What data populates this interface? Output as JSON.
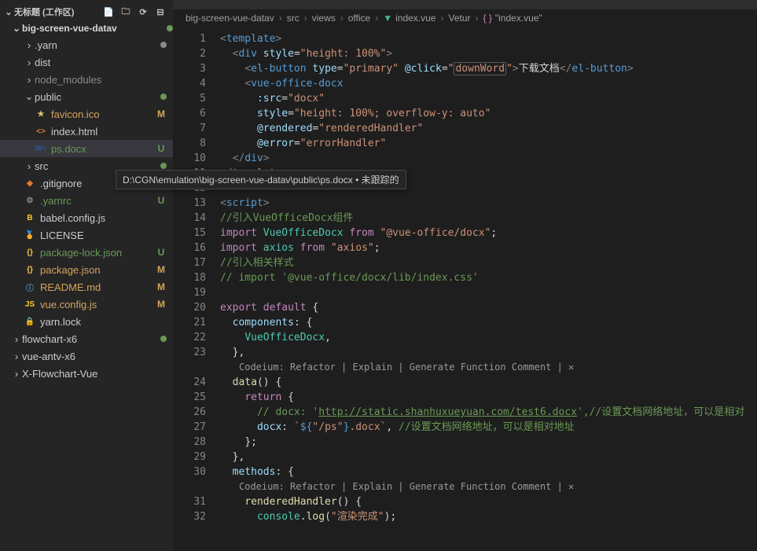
{
  "sidebar": {
    "title": "",
    "workspace": "无标题 (工作区)",
    "project": "big-screen-vue-datav",
    "tree": [
      {
        "depth": 1,
        "kind": "folder",
        "name": ".yarn",
        "status": "",
        "chev": ">",
        "cls": "fldr",
        "dot": "d"
      },
      {
        "depth": 1,
        "kind": "folder",
        "name": "dist",
        "status": "",
        "chev": ">",
        "cls": "fldr"
      },
      {
        "depth": 1,
        "kind": "folder",
        "name": "node_modules",
        "status": "",
        "chev": ">",
        "cls": "file-gray"
      },
      {
        "depth": 1,
        "kind": "folder",
        "name": "public",
        "status": "",
        "chev": "v",
        "cls": "fldr",
        "dot": "u",
        "active": false
      },
      {
        "depth": 2,
        "kind": "file",
        "name": "favicon.ico",
        "status": "M",
        "cls": "file-m",
        "icon": "star",
        "iconColor": "#e8c16f"
      },
      {
        "depth": 2,
        "kind": "file",
        "name": "index.html",
        "status": "",
        "cls": "file-n",
        "icon": "html",
        "iconColor": "#e37933"
      },
      {
        "depth": 2,
        "kind": "file",
        "name": "ps.docx",
        "status": "U",
        "cls": "file-u",
        "icon": "word",
        "iconColor": "#2b579a",
        "active": true
      },
      {
        "depth": 1,
        "kind": "folder",
        "name": "src",
        "status": "",
        "chev": ">",
        "cls": "fldr",
        "dot": "u"
      },
      {
        "depth": 1,
        "kind": "file",
        "name": ".gitignore",
        "status": "",
        "cls": "file-n",
        "icon": "git",
        "iconColor": "#e37933"
      },
      {
        "depth": 1,
        "kind": "file",
        "name": ".yarnrc",
        "status": "U",
        "cls": "file-u",
        "icon": "gear",
        "iconColor": "#8a8a8a"
      },
      {
        "depth": 1,
        "kind": "file",
        "name": "babel.config.js",
        "status": "",
        "cls": "file-n",
        "icon": "babel",
        "iconColor": "#ffca28"
      },
      {
        "depth": 1,
        "kind": "file",
        "name": "LICENSE",
        "status": "",
        "cls": "file-n",
        "icon": "cert",
        "iconColor": "#d4b73f"
      },
      {
        "depth": 1,
        "kind": "file",
        "name": "package-lock.json",
        "status": "U",
        "cls": "file-u",
        "icon": "json",
        "iconColor": "#f3c14b"
      },
      {
        "depth": 1,
        "kind": "file",
        "name": "package.json",
        "status": "M",
        "cls": "file-m",
        "icon": "json",
        "iconColor": "#f3c14b"
      },
      {
        "depth": 1,
        "kind": "file",
        "name": "README.md",
        "status": "M",
        "cls": "file-m",
        "icon": "info",
        "iconColor": "#519aba"
      },
      {
        "depth": 1,
        "kind": "file",
        "name": "vue.config.js",
        "status": "M",
        "cls": "file-m",
        "icon": "js",
        "iconColor": "#ffca28"
      },
      {
        "depth": 1,
        "kind": "file",
        "name": "yarn.lock",
        "status": "",
        "cls": "file-n",
        "icon": "lock",
        "iconColor": "#8a8a8a"
      },
      {
        "depth": 0,
        "kind": "folder",
        "name": "flowchart-x6",
        "status": "",
        "chev": ">",
        "cls": "fldr",
        "dot": "u"
      },
      {
        "depth": 0,
        "kind": "folder",
        "name": "vue-antv-x6",
        "status": "",
        "chev": ">",
        "cls": "fldr"
      },
      {
        "depth": 0,
        "kind": "folder",
        "name": "X-Flowchart-Vue",
        "status": "",
        "chev": ">",
        "cls": "fldr"
      }
    ]
  },
  "breadcrumbs": [
    "big-screen-vue-datav",
    "src",
    "views",
    "office",
    "index.vue",
    "Vetur",
    "\"index.vue\""
  ],
  "tooltip": "D:\\CGN\\emulation\\big-screen-vue-datav\\public\\ps.docx • 未跟踪的",
  "codelens": "Codeium: Refactor | Explain | Generate Function Comment | ✕",
  "lines": [
    1,
    2,
    3,
    4,
    5,
    6,
    7,
    8,
    10,
    11,
    12,
    13,
    14,
    15,
    16,
    17,
    18,
    19,
    20,
    21,
    22,
    23,
    24,
    25,
    26,
    27,
    28,
    29,
    30,
    31,
    32
  ],
  "code": {
    "l1": {
      "pre": "",
      "tag": "template"
    },
    "l2_attr": "style",
    "l2_val": "height: 100%",
    "l3_tag": "el-button",
    "l3_a1": "type",
    "l3_v1": "primary",
    "l3_a2": "@click",
    "l3_v2": "downWord",
    "l3_text": "下载文档",
    "l4_tag": "vue-office-docx",
    "l5_a": ":src",
    "l5_v": "docx",
    "l6_a": "style",
    "l6_v": "height: 100%; overflow-y: auto",
    "l7_a": "@rendered",
    "l7_v": "renderedHandler",
    "l8_a": "@error",
    "l8_v": "errorHandler",
    "l10": "div",
    "l11": "template",
    "l13_tag": "script",
    "l14": "//引入VueOfficeDocx组件",
    "l15_kw": "import",
    "l15_name": "VueOfficeDocx",
    "l15_from": "from",
    "l15_mod": "@vue-office/docx",
    "l16_kw": "import",
    "l16_name": "axios",
    "l16_from": "from",
    "l16_mod": "axios",
    "l17": "//引入相关样式",
    "l18": "// import '@vue-office/docx/lib/index.css'",
    "l20_a": "export",
    "l20_b": "default",
    "l21": "components",
    "l22": "VueOfficeDocx",
    "l24": "data",
    "l25": "return",
    "l26_cm": "// docx: '",
    "l26_url": "http://static.shanhuxueyuan.com/test6.docx",
    "l26_cm2": "',//设置文档网络地址，可以是相对",
    "l27_k": "docx",
    "l27_v": "/ps",
    "l27_ext": ".docx",
    "l27_cm": "//设置文档网络地址，可以是相对地址",
    "l30": "methods",
    "l31": "renderedHandler",
    "l32_fn": "log",
    "l32_str": "渲染完成"
  },
  "chart_data": null
}
